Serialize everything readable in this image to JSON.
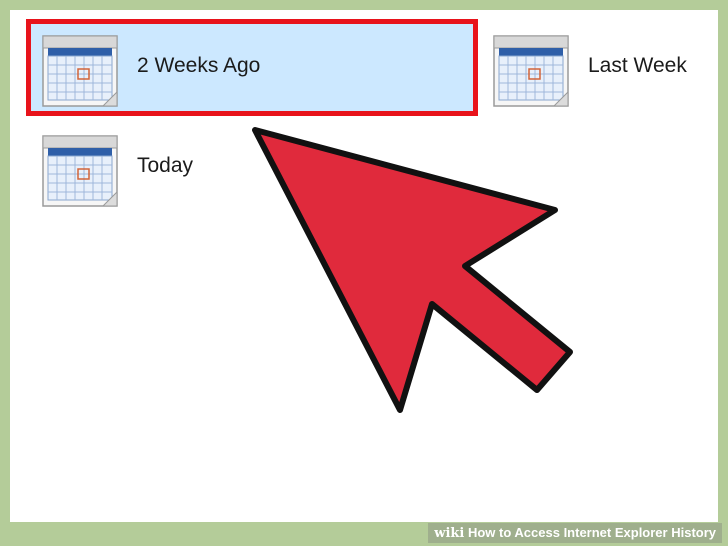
{
  "folders": [
    {
      "id": "2weeks",
      "label": "2 Weeks Ago",
      "icon": "calendar-icon",
      "selected": true
    },
    {
      "id": "lastweek",
      "label": "Last Week",
      "icon": "calendar-icon",
      "selected": false
    },
    {
      "id": "today",
      "label": "Today",
      "icon": "calendar-icon",
      "selected": false
    }
  ],
  "footer": {
    "site": "wiki",
    "title": "How to Access Internet Explorer History"
  },
  "colors": {
    "frame": "#b4cc99",
    "selection": "#cce8ff",
    "highlight_box": "#e8131b",
    "arrow": "#e02a3c"
  }
}
